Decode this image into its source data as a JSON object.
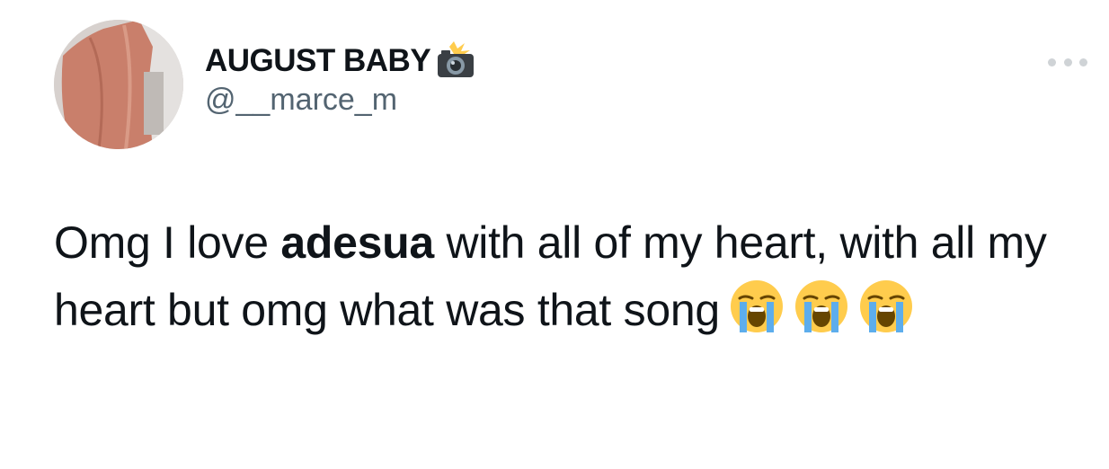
{
  "tweet": {
    "author": {
      "display_name": "AUGUST BABY",
      "name_emoji_icon": "camera-with-flash-icon",
      "handle": "@__marce_m",
      "avatar_icon": "avatar"
    },
    "more_icon": "ellipsis-icon",
    "text": {
      "part1": "Omg I love ",
      "mention": "adesua",
      "part2": " with all of my heart, with all my heart but omg what was that song",
      "emojis": [
        "loudly-crying-face-icon",
        "loudly-crying-face-icon",
        "loudly-crying-face-icon"
      ]
    }
  },
  "colors": {
    "text_primary": "#0f1419",
    "text_secondary": "#536471",
    "dots": "#cfd3d6",
    "emoji_yellow": "#ffcc4d",
    "emoji_tears": "#5dadec"
  }
}
